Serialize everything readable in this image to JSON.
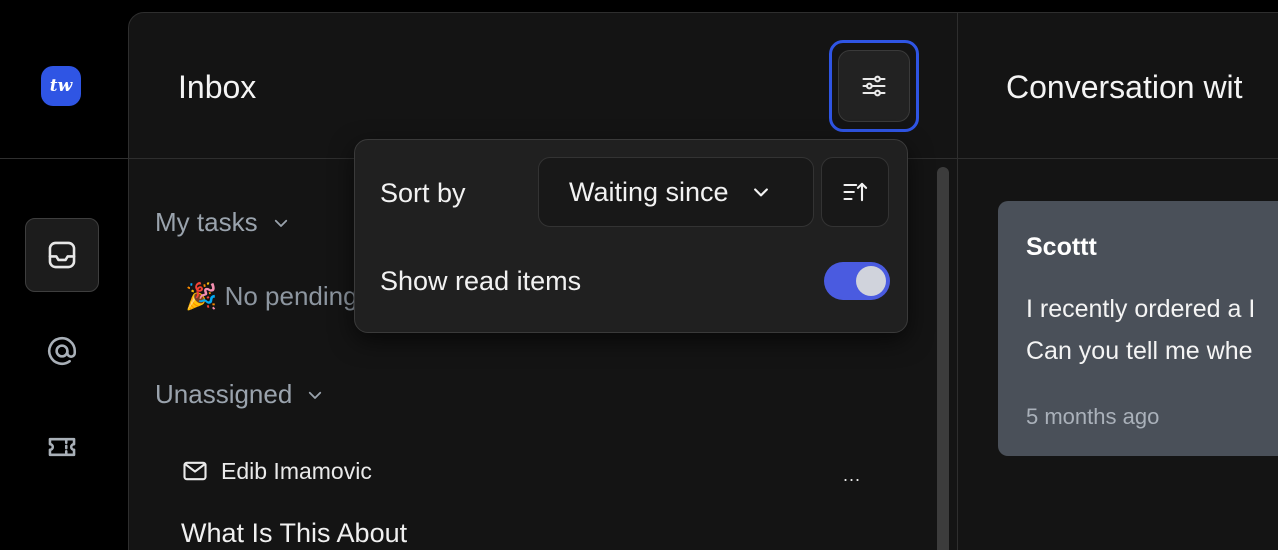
{
  "rail": {
    "logo_text": "tw",
    "items": [
      {
        "icon": "inbox-icon",
        "active": true
      },
      {
        "icon": "at-icon",
        "active": false
      },
      {
        "icon": "ticket-icon",
        "active": false
      }
    ]
  },
  "inbox": {
    "title": "Inbox",
    "filter_icon": "sliders-icon",
    "sections": {
      "my_tasks": "My tasks",
      "my_tasks_empty": "🎉 No pending",
      "unassigned": "Unassigned"
    },
    "rows": [
      {
        "icon": "mail-icon",
        "sender": "Edib Imamovic",
        "more": "...",
        "subject": "What Is This About"
      }
    ]
  },
  "popover": {
    "sort_label": "Sort by",
    "sort_value": "Waiting since",
    "sort_direction_icon": "sort-ascending-icon",
    "show_read_label": "Show read items",
    "show_read_enabled": true
  },
  "conversation": {
    "title": "Conversation wit",
    "message": {
      "author": "Scottt",
      "line1": "I recently ordered a I",
      "line2": "Can you tell me whe",
      "time": "5 months ago"
    }
  },
  "colors": {
    "accent": "#2f55e4",
    "toggle_on": "#4a5be0",
    "message_bg": "#4a5059"
  }
}
